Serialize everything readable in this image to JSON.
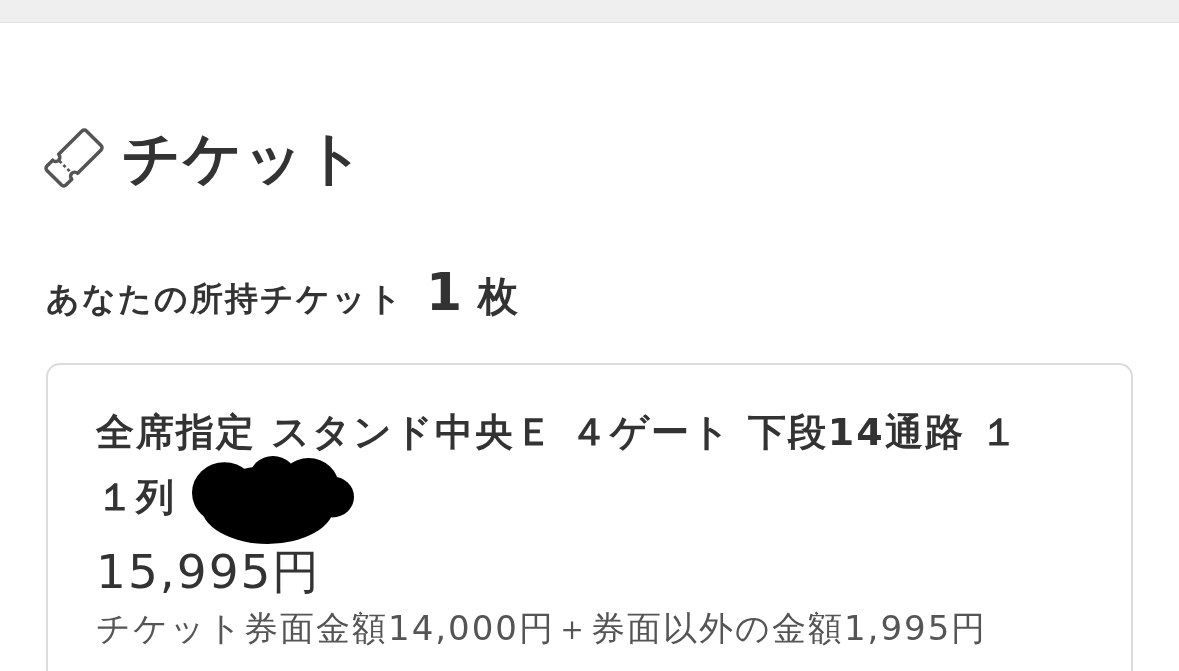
{
  "section": {
    "title": "チケット"
  },
  "owned": {
    "label": "あなたの所持チケット",
    "count": "1",
    "unit": "枚"
  },
  "tickets": [
    {
      "seat_lines": [
        "全席指定 スタンド中央Ｅ ４ゲート 下段14通路 １",
        "１列"
      ],
      "redacted": true,
      "price": "15,995円",
      "breakdown": "チケット券面金額14,000円＋券面以外の金額1,995円"
    }
  ]
}
